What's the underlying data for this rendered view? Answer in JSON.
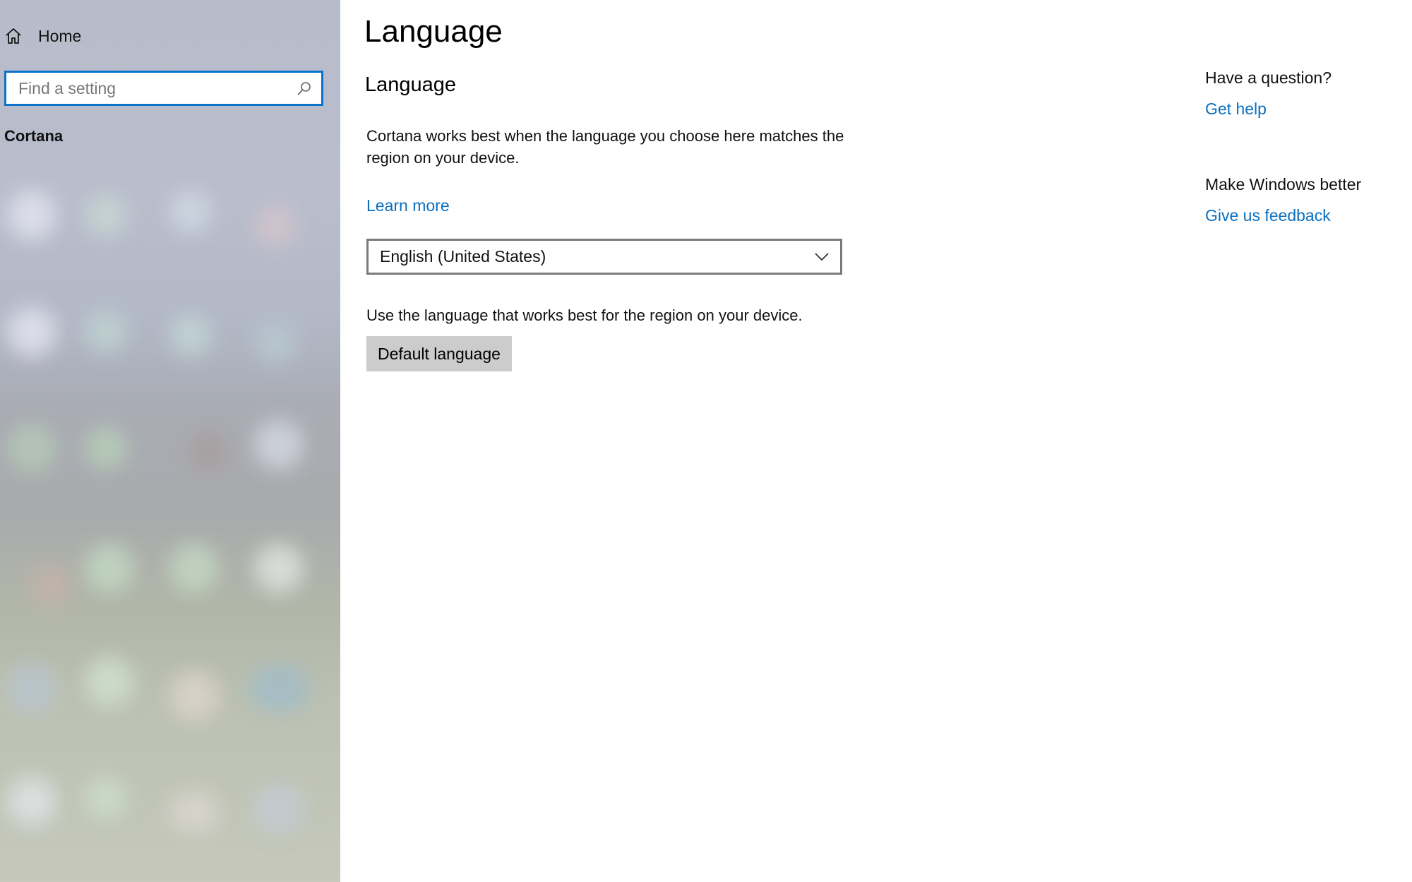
{
  "sidebar": {
    "home_label": "Home",
    "search": {
      "placeholder": "Find a setting",
      "value": ""
    },
    "section_label": "Cortana"
  },
  "main": {
    "title": "Language",
    "subtitle": "Language",
    "description": "Cortana works best when the language you choose here matches the region on your device.",
    "learn_more": "Learn more",
    "dropdown": {
      "selected": "English (United States)"
    },
    "hint": "Use the language that works best for the region on your device.",
    "default_button": "Default language"
  },
  "right_rail": {
    "question_heading": "Have a question?",
    "get_help": "Get help",
    "feedback_heading": "Make Windows better",
    "give_feedback": "Give us feedback"
  },
  "colors": {
    "accent": "#0a73c9",
    "link": "#0a6fbf",
    "button_bg": "#cccccc"
  },
  "icons": {
    "home": "home-icon",
    "search": "search-icon",
    "dropdown": "chevron-down-icon"
  }
}
